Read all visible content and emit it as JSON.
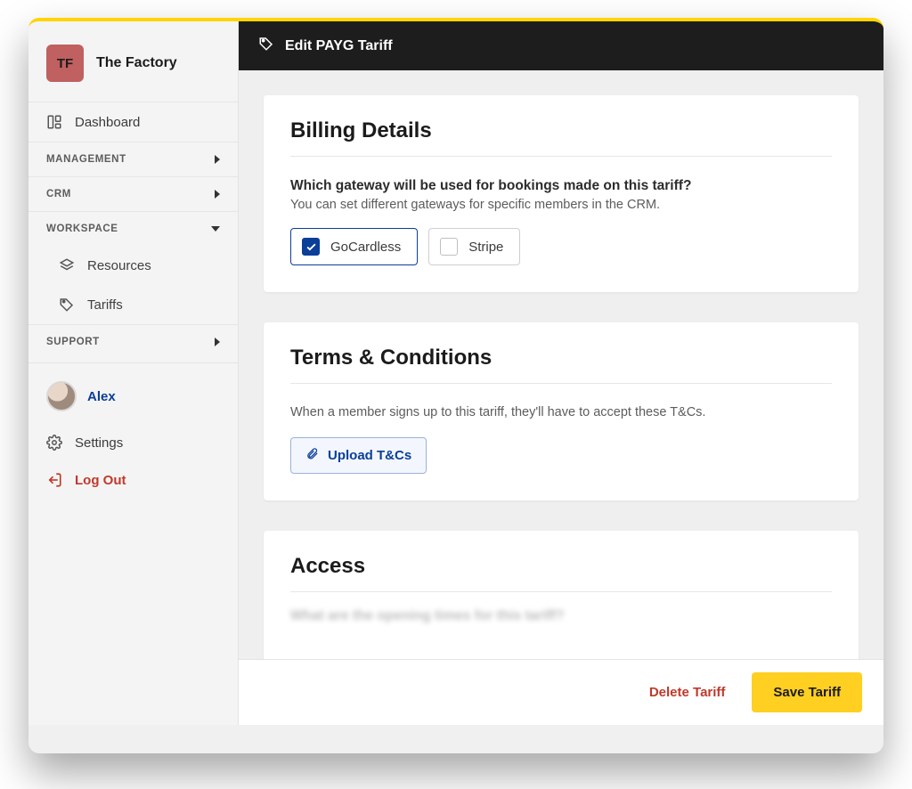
{
  "org": {
    "badge": "TF",
    "name": "The Factory"
  },
  "sidebar": {
    "dashboard": "Dashboard",
    "sections": {
      "management": "MANAGEMENT",
      "crm": "CRM",
      "workspace": "WORKSPACE",
      "support": "SUPPORT"
    },
    "workspace_items": [
      "Resources",
      "Tariffs"
    ],
    "user": "Alex",
    "settings": "Settings",
    "logout": "Log Out"
  },
  "header": {
    "title": "Edit PAYG Tariff"
  },
  "billing": {
    "heading": "Billing Details",
    "question": "Which gateway will be used for bookings made on this tariff?",
    "help": "You can set different gateways for specific members in the CRM.",
    "gateways": [
      {
        "label": "GoCardless",
        "checked": true
      },
      {
        "label": "Stripe",
        "checked": false
      }
    ]
  },
  "terms": {
    "heading": "Terms & Conditions",
    "desc": "When a member signs up to this tariff, they'll have to accept these T&Cs.",
    "upload_label": "Upload T&Cs"
  },
  "access": {
    "heading": "Access",
    "blurred_question": "What are the opening times for this tariff?"
  },
  "footer": {
    "delete": "Delete Tariff",
    "save": "Save Tariff"
  }
}
